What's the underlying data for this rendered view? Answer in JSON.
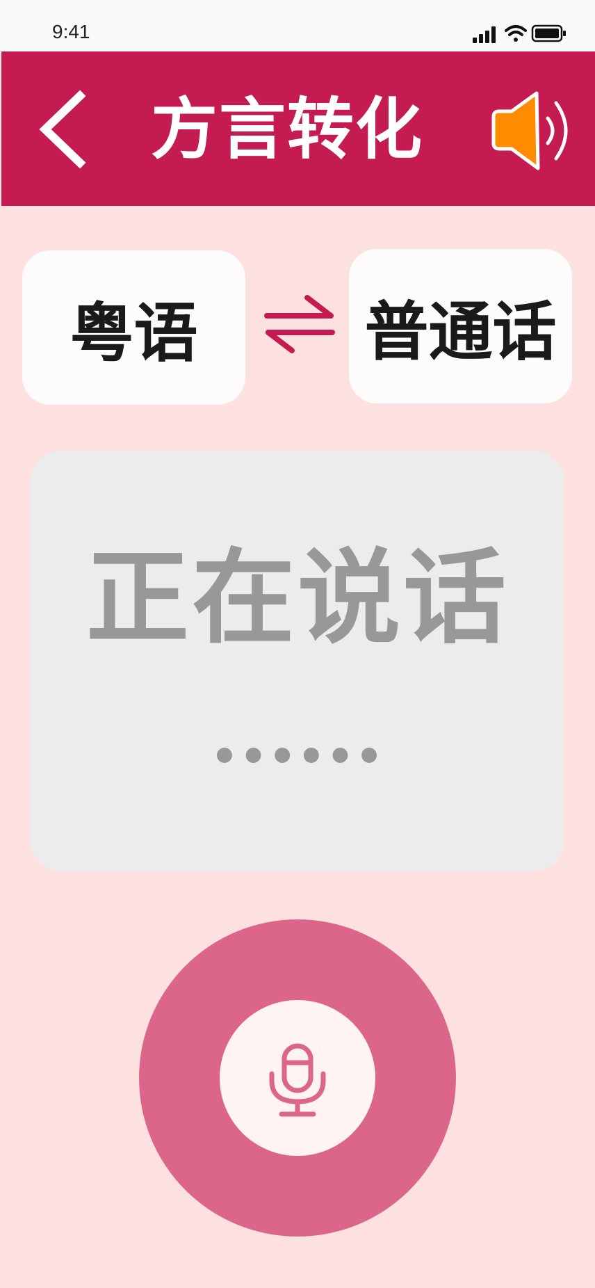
{
  "status_bar": {
    "time": "9:41",
    "icons": [
      "signal-icon",
      "wifi-icon",
      "battery-icon"
    ]
  },
  "header": {
    "title": "方言转化",
    "back_icon": "back-arrow-icon",
    "speaker_icon": "speaker-icon"
  },
  "languages": {
    "source": "粤语",
    "target": "普通话",
    "swap_icon": "swap-arrows-icon"
  },
  "speech_panel": {
    "status": "正在说话",
    "dots": "••••••"
  },
  "mic": {
    "icon": "microphone-icon"
  },
  "colors": {
    "header_bg": "#c41b51",
    "page_bg": "#fde0e0",
    "speaker_fill": "#ff8c00",
    "mic_outer": "#dc6689",
    "mic_inner": "#fff3f3",
    "panel_bg": "#ececec",
    "panel_text": "#989898"
  }
}
